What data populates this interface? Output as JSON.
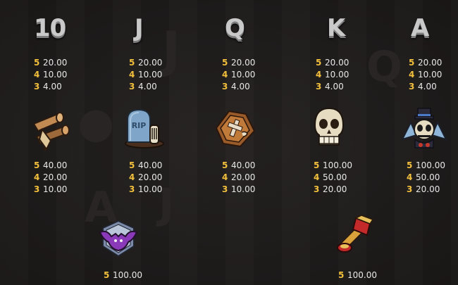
{
  "paytable": {
    "letters": [
      {
        "symbol": "10",
        "icon": "10-letter-icon",
        "pays": [
          {
            "count": "5",
            "value": "20.00"
          },
          {
            "count": "4",
            "value": "10.00"
          },
          {
            "count": "3",
            "value": "4.00"
          }
        ]
      },
      {
        "symbol": "J",
        "icon": "j-letter-icon",
        "pays": [
          {
            "count": "5",
            "value": "20.00"
          },
          {
            "count": "4",
            "value": "10.00"
          },
          {
            "count": "3",
            "value": "4.00"
          }
        ]
      },
      {
        "symbol": "Q",
        "icon": "q-letter-icon",
        "pays": [
          {
            "count": "5",
            "value": "20.00"
          },
          {
            "count": "4",
            "value": "10.00"
          },
          {
            "count": "3",
            "value": "4.00"
          }
        ]
      },
      {
        "symbol": "K",
        "icon": "k-letter-icon",
        "pays": [
          {
            "count": "5",
            "value": "20.00"
          },
          {
            "count": "4",
            "value": "10.00"
          },
          {
            "count": "3",
            "value": "4.00"
          }
        ]
      },
      {
        "symbol": "A",
        "icon": "a-letter-icon",
        "pays": [
          {
            "count": "5",
            "value": "20.00"
          },
          {
            "count": "4",
            "value": "10.00"
          },
          {
            "count": "3",
            "value": "4.00"
          }
        ]
      }
    ],
    "premiums": [
      {
        "icon": "wooden-stakes-icon",
        "pays": [
          {
            "count": "5",
            "value": "40.00"
          },
          {
            "count": "4",
            "value": "20.00"
          },
          {
            "count": "3",
            "value": "10.00"
          }
        ]
      },
      {
        "icon": "rip-gravestone-icon",
        "tombstone_text": "RIP",
        "pays": [
          {
            "count": "5",
            "value": "40.00"
          },
          {
            "count": "4",
            "value": "20.00"
          },
          {
            "count": "3",
            "value": "10.00"
          }
        ]
      },
      {
        "icon": "coffin-icon",
        "pays": [
          {
            "count": "5",
            "value": "40.00"
          },
          {
            "count": "4",
            "value": "20.00"
          },
          {
            "count": "3",
            "value": "10.00"
          }
        ]
      },
      {
        "icon": "skull-icon",
        "pays": [
          {
            "count": "5",
            "value": "100.00"
          },
          {
            "count": "4",
            "value": "50.00"
          },
          {
            "count": "3",
            "value": "20.00"
          }
        ]
      },
      {
        "icon": "top-hat-skull-icon",
        "pays": [
          {
            "count": "5",
            "value": "100.00"
          },
          {
            "count": "4",
            "value": "50.00"
          },
          {
            "count": "3",
            "value": "20.00"
          }
        ]
      }
    ],
    "specials": [
      {
        "icon": "bat-emblem-icon",
        "pays": [
          {
            "count": "5",
            "value": "100.00"
          }
        ]
      },
      {
        "icon": "blood-chalice-icon",
        "pays": [
          {
            "count": "5",
            "value": "100.00"
          }
        ]
      }
    ],
    "colors": {
      "count": "#f2c03c",
      "value": "#e8e8e8",
      "background": "#1e1b1b",
      "letter": "#c9c9c9"
    }
  }
}
